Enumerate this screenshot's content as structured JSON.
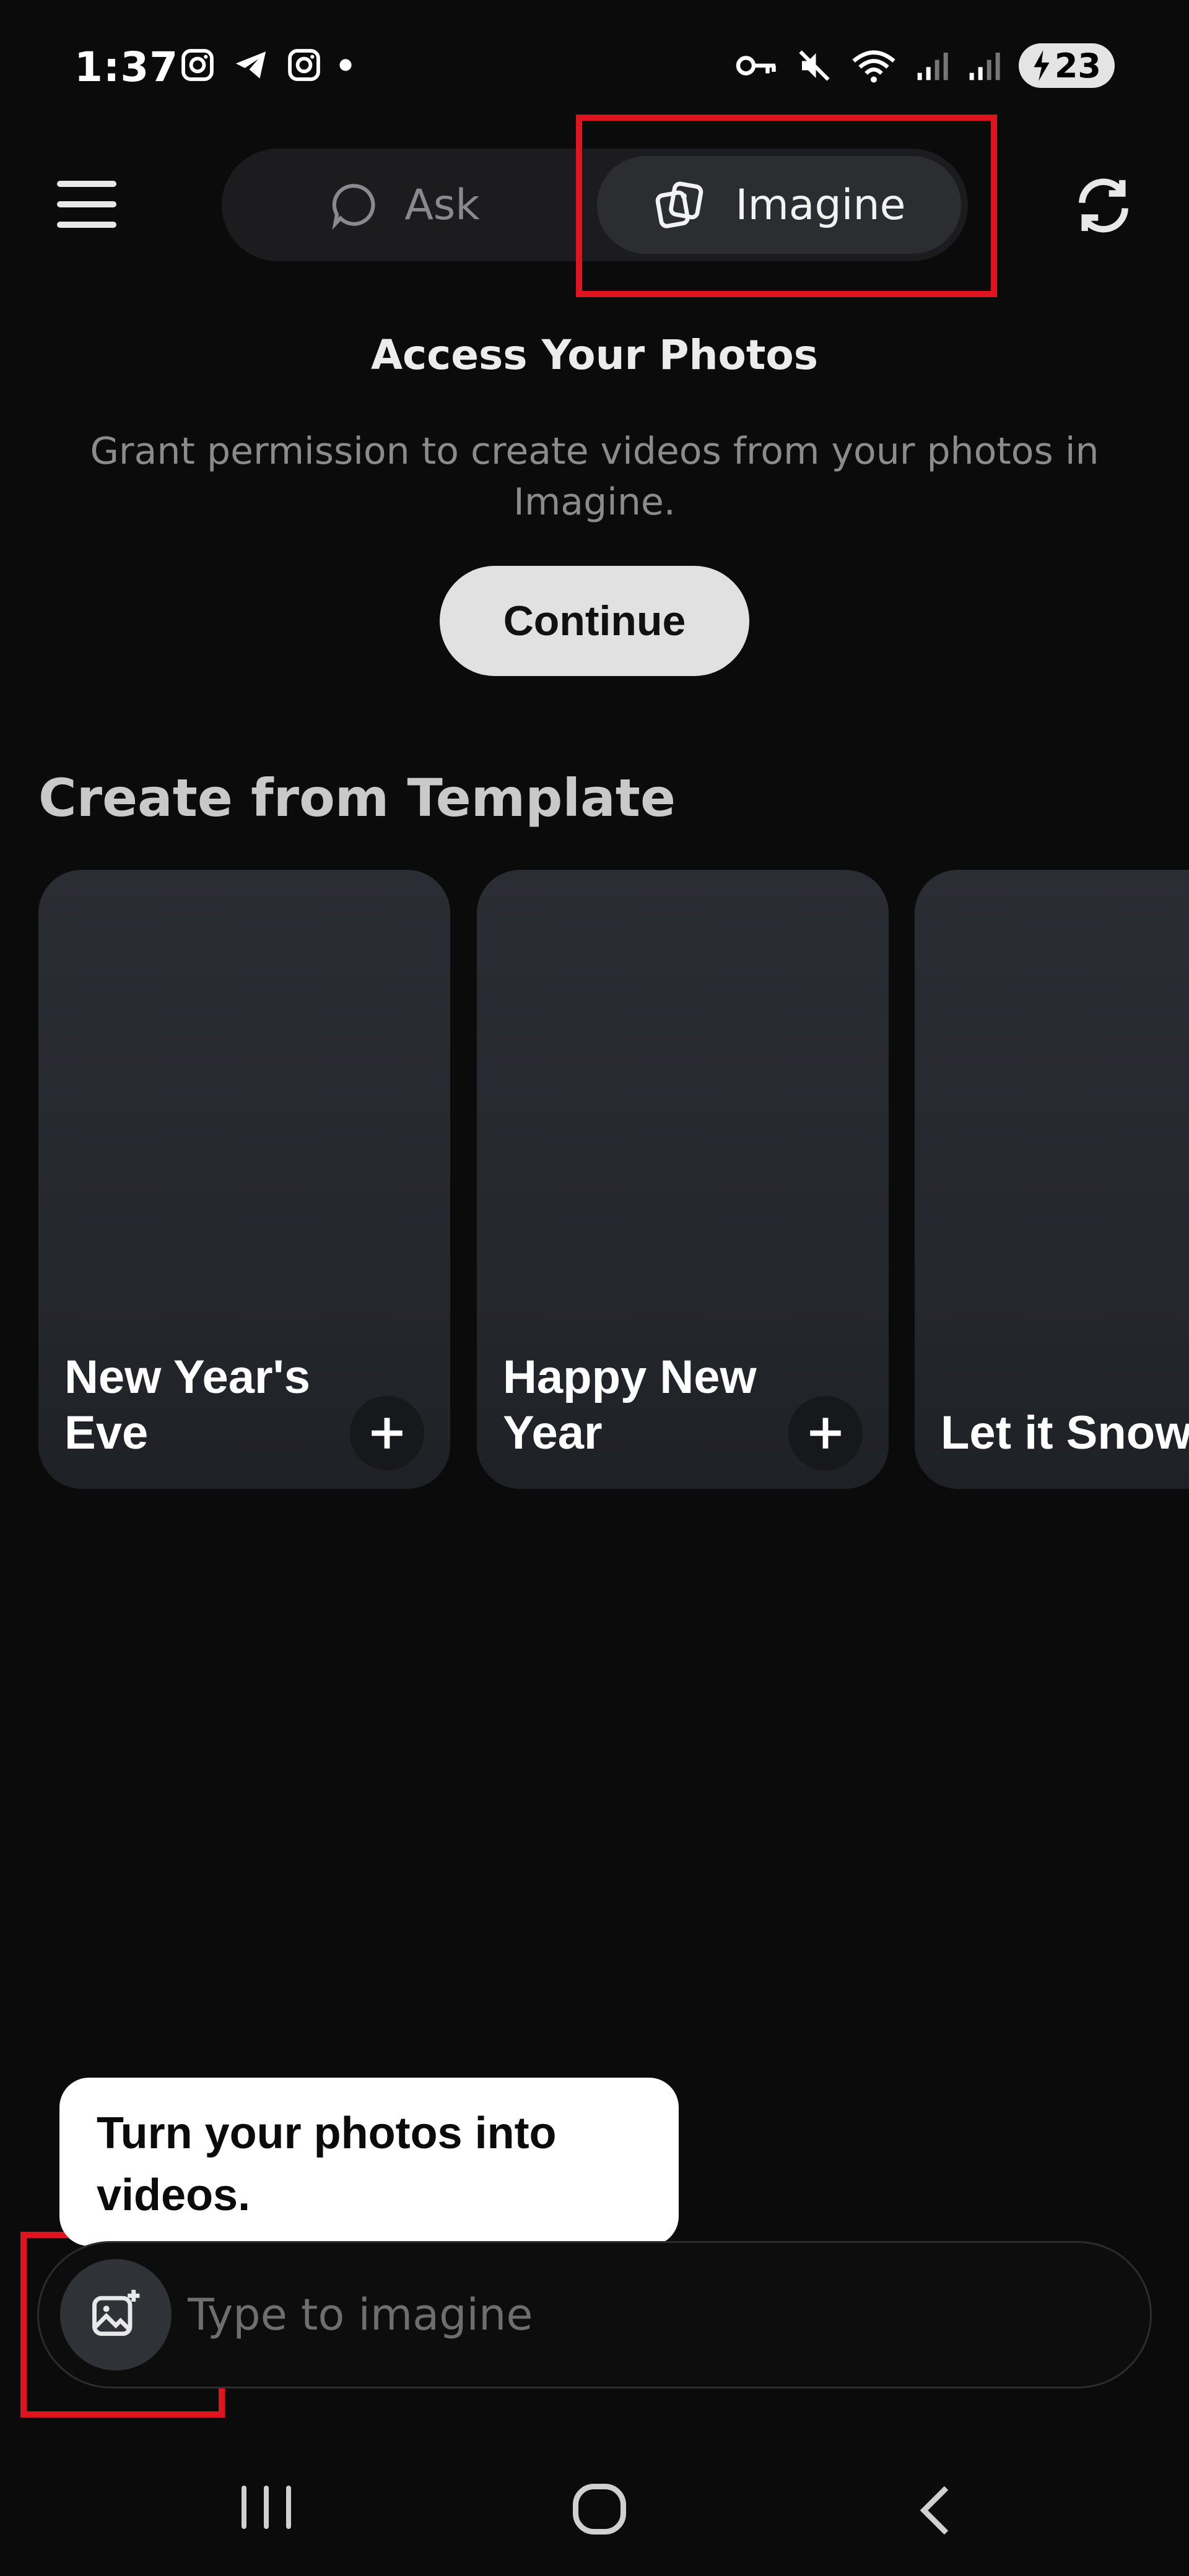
{
  "status_bar": {
    "time": "1:37",
    "battery": "23",
    "icons": [
      "instagram-icon",
      "telegram-icon",
      "instagram-icon",
      "dot-icon",
      "key-icon",
      "mute-icon",
      "wifi-icon",
      "signal-icon",
      "signal-icon",
      "battery-icon"
    ]
  },
  "top_bar": {
    "ask_label": "Ask",
    "imagine_label": "Imagine"
  },
  "access": {
    "title": "Access Your Photos",
    "description": "Grant permission to create videos from your photos in Imagine.",
    "continue_label": "Continue"
  },
  "templates": {
    "title": "Create from Template",
    "items": [
      {
        "label": "New Year's Eve"
      },
      {
        "label": "Happy New Year"
      },
      {
        "label": "Let it Snow"
      }
    ]
  },
  "tooltip": {
    "text": "Turn your photos into videos."
  },
  "input": {
    "placeholder": "Type to imagine"
  },
  "colors": {
    "background": "#0b0b0b",
    "highlight": "#e0141e",
    "card": "#24272c",
    "toggle": "#1c1c1e"
  }
}
